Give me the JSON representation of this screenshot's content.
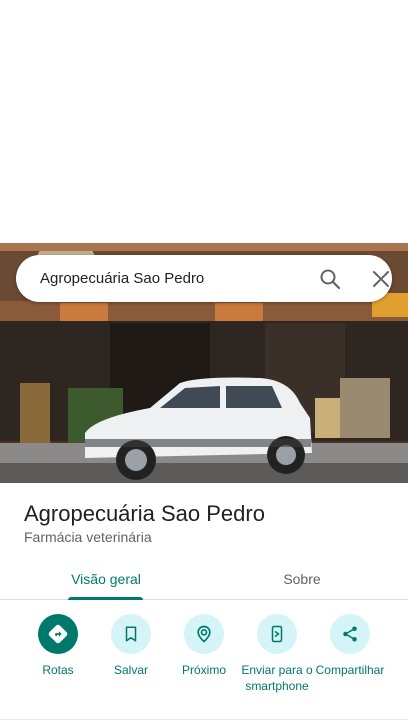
{
  "search": {
    "query": "Agropecuária Sao Pedro"
  },
  "place": {
    "name": "Agropecuária Sao Pedro",
    "category": "Farmácia veterinária"
  },
  "tabs": [
    {
      "label": "Visão geral",
      "active": true
    },
    {
      "label": "Sobre",
      "active": false
    }
  ],
  "actions": [
    {
      "label": "Rotas",
      "icon": "directions-icon"
    },
    {
      "label": "Salvar",
      "icon": "bookmark-icon"
    },
    {
      "label": "Próximo",
      "icon": "nearby-icon"
    },
    {
      "label": "Enviar para o smartphone",
      "icon": "send-to-phone-icon"
    },
    {
      "label": "Compartilhar",
      "icon": "share-icon"
    }
  ],
  "colors": {
    "accent": "#00796b",
    "action_bg": "#d4f4f8"
  }
}
